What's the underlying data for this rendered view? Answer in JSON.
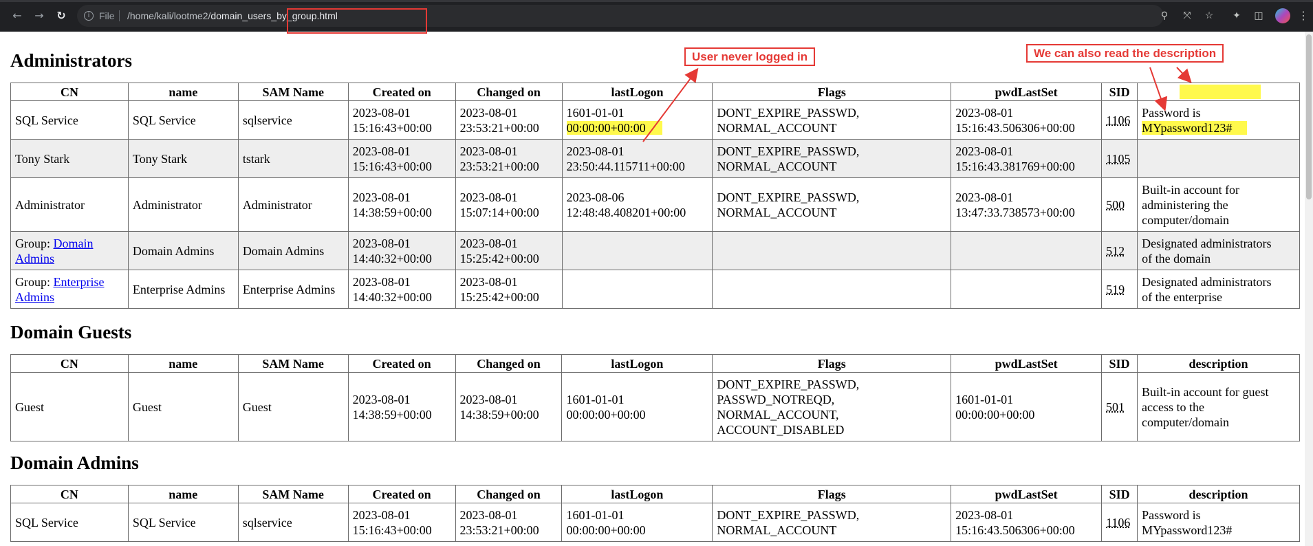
{
  "browser": {
    "file_label": "File",
    "url_dir": "/home/kali/lootme2/",
    "url_file": "domain_users_by_group.html",
    "icons": [
      "back-icon",
      "forward-icon",
      "reload-icon",
      "info-icon",
      "zoom-icon",
      "share-icon",
      "star-icon",
      "extensions-icon",
      "sidebar-icon",
      "avatar",
      "menu-icon"
    ]
  },
  "columns": [
    "CN",
    "name",
    "SAM Name",
    "Created on",
    "Changed on",
    "lastLogon",
    "Flags",
    "pwdLastSet",
    "SID",
    "description"
  ],
  "sections": [
    {
      "title": "Administrators",
      "rows": [
        {
          "cn": "SQL Service",
          "name": "SQL Service",
          "sam": "sqlservice",
          "created": [
            "2023-08-01",
            "15:16:43+00:00"
          ],
          "changed": [
            "2023-08-01",
            "23:53:21+00:00"
          ],
          "lastlogon": [
            "1601-01-01",
            "00:00:00+00:00"
          ],
          "flags": [
            "DONT_EXPIRE_PASSWD,",
            "NORMAL_ACCOUNT"
          ],
          "pwdlastset": [
            "2023-08-01",
            "15:16:43.506306+00:00"
          ],
          "sid": "1106",
          "desc": [
            "Password is",
            "MYpassword123#"
          ]
        },
        {
          "cn": "Tony Stark",
          "name": "Tony Stark",
          "sam": "tstark",
          "created": [
            "2023-08-01",
            "15:16:43+00:00"
          ],
          "changed": [
            "2023-08-01",
            "23:53:21+00:00"
          ],
          "lastlogon": [
            "2023-08-01",
            "23:50:44.115711+00:00"
          ],
          "flags": [
            "DONT_EXPIRE_PASSWD,",
            "NORMAL_ACCOUNT"
          ],
          "pwdlastset": [
            "2023-08-01",
            "15:16:43.381769+00:00"
          ],
          "sid": "1105",
          "desc": []
        },
        {
          "cn": "Administrator",
          "name": "Administrator",
          "sam": "Administrator",
          "created": [
            "2023-08-01",
            "14:38:59+00:00"
          ],
          "changed": [
            "2023-08-01",
            "15:07:14+00:00"
          ],
          "lastlogon": [
            "2023-08-06",
            "12:48:48.408201+00:00"
          ],
          "flags": [
            "DONT_EXPIRE_PASSWD,",
            "NORMAL_ACCOUNT"
          ],
          "pwdlastset": [
            "2023-08-01",
            "13:47:33.738573+00:00"
          ],
          "sid": "500",
          "desc": [
            "Built-in account for",
            "administering the",
            "computer/domain"
          ]
        },
        {
          "cn_prefix": "Group: ",
          "cn_link": "Domain Admins",
          "name": "Domain Admins",
          "sam": "Domain Admins",
          "created": [
            "2023-08-01",
            "14:40:32+00:00"
          ],
          "changed": [
            "2023-08-01",
            "15:25:42+00:00"
          ],
          "lastlogon": [],
          "flags": [],
          "pwdlastset": [],
          "sid": "512",
          "desc": [
            "Designated administrators",
            "of the domain"
          ]
        },
        {
          "cn_prefix": "Group: ",
          "cn_link": "Enterprise Admins",
          "name": "Enterprise Admins",
          "sam": "Enterprise Admins",
          "created": [
            "2023-08-01",
            "14:40:32+00:00"
          ],
          "changed": [
            "2023-08-01",
            "15:25:42+00:00"
          ],
          "lastlogon": [],
          "flags": [],
          "pwdlastset": [],
          "sid": "519",
          "desc": [
            "Designated administrators",
            "of the enterprise"
          ]
        }
      ]
    },
    {
      "title": "Domain Guests",
      "rows": [
        {
          "cn": "Guest",
          "name": "Guest",
          "sam": "Guest",
          "created": [
            "2023-08-01",
            "14:38:59+00:00"
          ],
          "changed": [
            "2023-08-01",
            "14:38:59+00:00"
          ],
          "lastlogon": [
            "1601-01-01",
            "00:00:00+00:00"
          ],
          "flags": [
            "DONT_EXPIRE_PASSWD,",
            "PASSWD_NOTREQD,",
            "NORMAL_ACCOUNT,",
            "ACCOUNT_DISABLED"
          ],
          "pwdlastset": [
            "1601-01-01",
            "00:00:00+00:00"
          ],
          "sid": "501",
          "desc": [
            "Built-in account for guest",
            "access to the",
            "computer/domain"
          ]
        }
      ]
    },
    {
      "title": "Domain Admins",
      "rows": [
        {
          "cn": "SQL Service",
          "name": "SQL Service",
          "sam": "sqlservice",
          "created": [
            "2023-08-01",
            "15:16:43+00:00"
          ],
          "changed": [
            "2023-08-01",
            "23:53:21+00:00"
          ],
          "lastlogon": [
            "1601-01-01",
            "00:00:00+00:00"
          ],
          "flags": [
            "DONT_EXPIRE_PASSWD,",
            "NORMAL_ACCOUNT"
          ],
          "pwdlastset": [
            "2023-08-01",
            "15:16:43.506306+00:00"
          ],
          "sid": "1106",
          "desc": [
            "Password is",
            "MYpassword123#"
          ]
        }
      ]
    }
  ],
  "annotations": {
    "never_logged_in": "User never logged in",
    "read_description": "We can also read the description"
  },
  "colors": {
    "annotation": "#e53935",
    "highlight": "#fff94c",
    "link": "#0000ee",
    "alt_row": "#eeeeee"
  }
}
